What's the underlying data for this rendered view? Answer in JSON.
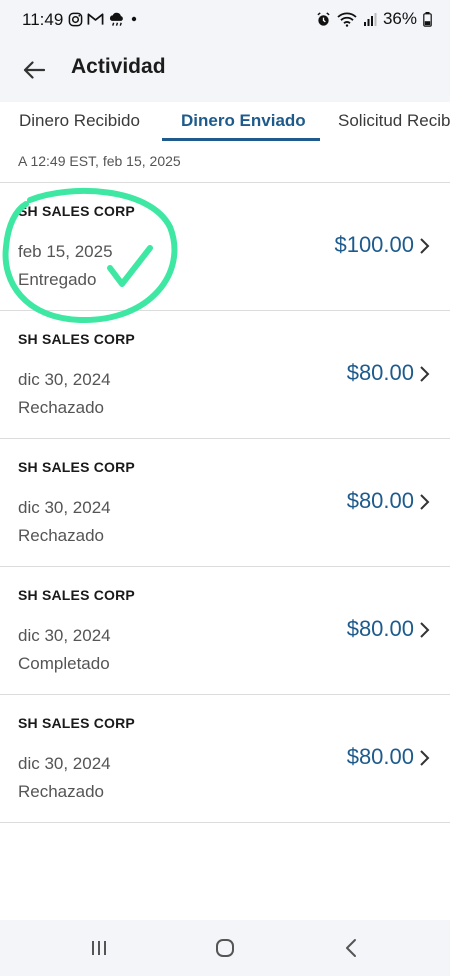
{
  "status_bar": {
    "time": "11:49",
    "battery": "36%",
    "icons": [
      "instagram-icon",
      "gmail-icon",
      "weather-icon",
      "dot-icon",
      "alarm-icon",
      "wifi-icon",
      "signal-icon",
      "battery-icon"
    ]
  },
  "app_bar": {
    "title": "Actividad",
    "back_icon": "arrow-left-icon"
  },
  "tabs": [
    {
      "label": "Dinero Recibido",
      "active": false
    },
    {
      "label": "Dinero Enviado",
      "active": true
    },
    {
      "label": "Solicitud Recib",
      "active": false
    }
  ],
  "timestamp": "A 12:49 EST, feb 15, 2025",
  "transactions": [
    {
      "name": "SH SALES CORP",
      "date": "feb 15, 2025",
      "status": "Entregado",
      "amount": "$100.00"
    },
    {
      "name": "SH SALES CORP",
      "date": "dic 30, 2024",
      "status": "Rechazado",
      "amount": "$80.00"
    },
    {
      "name": "SH SALES CORP",
      "date": "dic 30, 2024",
      "status": "Rechazado",
      "amount": "$80.00"
    },
    {
      "name": "SH SALES CORP",
      "date": "dic 30, 2024",
      "status": "Completado",
      "amount": "$80.00"
    },
    {
      "name": "SH SALES CORP",
      "date": "dic 30, 2024",
      "status": "Rechazado",
      "amount": "$80.00"
    }
  ],
  "colors": {
    "accent": "#1e5b8c",
    "annotation": "#3ee7a2",
    "header_bg": "#f3f5f8"
  },
  "nav_bar": {
    "icons": [
      "recent-apps-icon",
      "home-icon",
      "back-icon"
    ]
  }
}
